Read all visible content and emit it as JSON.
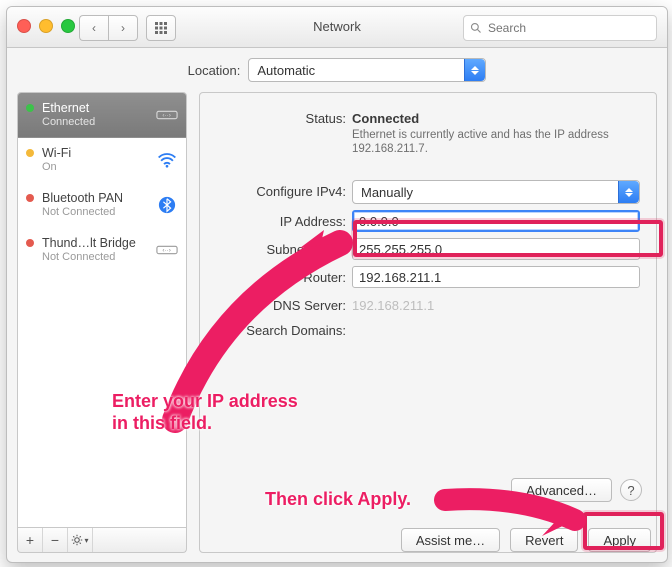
{
  "window": {
    "title": "Network",
    "search_placeholder": "Search"
  },
  "location": {
    "label": "Location:",
    "value": "Automatic"
  },
  "services": [
    {
      "name": "Ethernet",
      "status_text": "Connected",
      "status_color": "green",
      "icon": "ethernet",
      "selected": true
    },
    {
      "name": "Wi-Fi",
      "status_text": "On",
      "status_color": "yellow",
      "icon": "wifi",
      "selected": false
    },
    {
      "name": "Bluetooth PAN",
      "status_text": "Not Connected",
      "status_color": "red",
      "icon": "bluetooth",
      "selected": false
    },
    {
      "name": "Thund…lt Bridge",
      "status_text": "Not Connected",
      "status_color": "red",
      "icon": "ethernet",
      "selected": false
    }
  ],
  "detail": {
    "status_label": "Status:",
    "status_value": "Connected",
    "status_desc": "Ethernet is currently active and has the IP address 192.168.211.7.",
    "configure_label": "Configure IPv4:",
    "configure_value": "Manually",
    "ip_label": "IP Address:",
    "ip_value": "0.0.0.0",
    "subnet_label": "Subnet Mask:",
    "subnet_value": "255.255.255.0",
    "router_label": "Router:",
    "router_value": "192.168.211.1",
    "dns_label": "DNS Server:",
    "dns_value": "192.168.211.1",
    "search_label": "Search Domains:",
    "search_value": ""
  },
  "buttons": {
    "advanced": "Advanced…",
    "assist": "Assist me…",
    "revert": "Revert",
    "apply": "Apply"
  },
  "toolbar": {
    "add": "+",
    "remove": "−"
  },
  "annotations": {
    "line1": "Enter your IP address",
    "line2": "in this field.",
    "line3": "Then click Apply."
  }
}
